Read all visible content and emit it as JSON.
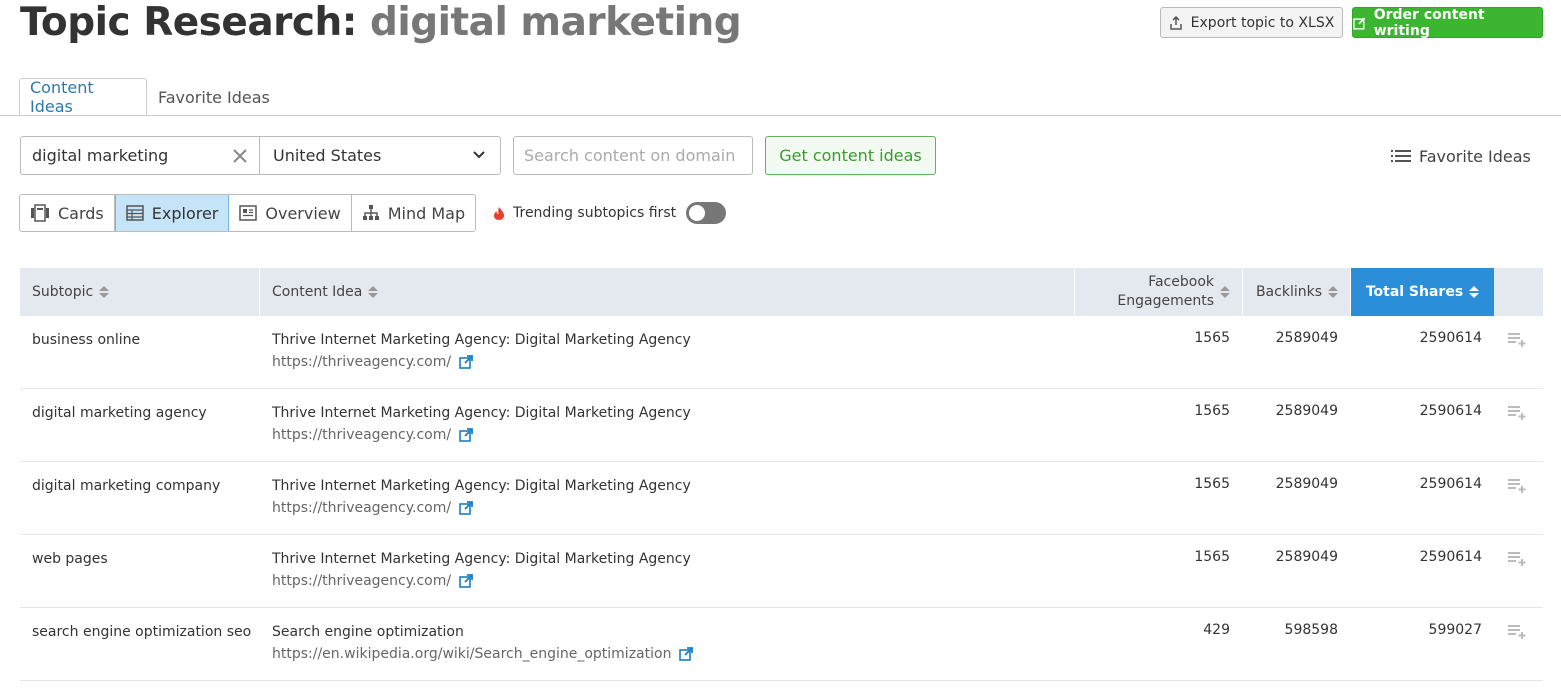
{
  "header": {
    "title_prefix": "Topic Research:",
    "title_keyword": "digital marketing",
    "export_label": "Export topic to XLSX",
    "order_label": "Order content writing"
  },
  "tabs": [
    {
      "label": "Content Ideas",
      "active": true
    },
    {
      "label": "Favorite Ideas",
      "active": false
    }
  ],
  "search": {
    "keyword": "digital marketing",
    "country": "United States",
    "domain_placeholder": "Search content on domain",
    "get_label": "Get content ideas",
    "favorites_label": "Favorite Ideas"
  },
  "views": [
    {
      "label": "Cards",
      "icon": "cards-icon",
      "active": false
    },
    {
      "label": "Explorer",
      "icon": "table-icon",
      "active": true
    },
    {
      "label": "Overview",
      "icon": "overview-icon",
      "active": false
    },
    {
      "label": "Mind Map",
      "icon": "mindmap-icon",
      "active": false
    }
  ],
  "trending": {
    "label": "Trending subtopics first",
    "enabled": false
  },
  "table": {
    "columns": {
      "subtopic": "Subtopic",
      "content_idea": "Content Idea",
      "fb_line1": "Facebook",
      "fb_line2": "Engagements",
      "backlinks": "Backlinks",
      "total_shares": "Total Shares"
    },
    "rows": [
      {
        "subtopic": "business online",
        "title": "Thrive Internet Marketing Agency: Digital Marketing Agency",
        "url": "https://thriveagency.com/",
        "fb": "1565",
        "backlinks": "2589049",
        "total": "2590614"
      },
      {
        "subtopic": "digital marketing agency",
        "title": "Thrive Internet Marketing Agency: Digital Marketing Agency",
        "url": "https://thriveagency.com/",
        "fb": "1565",
        "backlinks": "2589049",
        "total": "2590614"
      },
      {
        "subtopic": "digital marketing company",
        "title": "Thrive Internet Marketing Agency: Digital Marketing Agency",
        "url": "https://thriveagency.com/",
        "fb": "1565",
        "backlinks": "2589049",
        "total": "2590614"
      },
      {
        "subtopic": "web pages",
        "title": "Thrive Internet Marketing Agency: Digital Marketing Agency",
        "url": "https://thriveagency.com/",
        "fb": "1565",
        "backlinks": "2589049",
        "total": "2590614"
      },
      {
        "subtopic": "search engine optimization seo",
        "title": "Search engine optimization",
        "url": "https://en.wikipedia.org/wiki/Search_engine_optimization",
        "fb": "429",
        "backlinks": "598598",
        "total": "599027"
      }
    ]
  },
  "colors": {
    "accent_green": "#3cb531",
    "accent_blue": "#2a8fd8",
    "tab_active": "#2a7ab0",
    "link_icon": "#1a7fc4"
  }
}
